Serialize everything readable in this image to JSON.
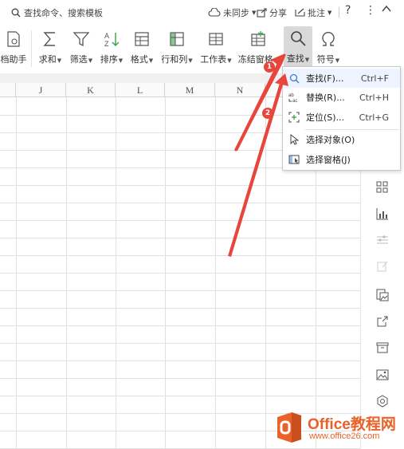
{
  "topbar": {
    "search_placeholder": "查找命令、搜索模板",
    "sync_label": "未同步",
    "share_label": "分享",
    "comment_label": "批注",
    "help_label": "?",
    "more_label": "⋮",
    "collapse_label": "^"
  },
  "ribbon": {
    "items": [
      {
        "label": "档助手",
        "icon": "doc-assistant-icon"
      },
      {
        "label": "求和",
        "icon": "sum-icon",
        "dropdown": true
      },
      {
        "label": "筛选",
        "icon": "filter-icon",
        "dropdown": true
      },
      {
        "label": "排序",
        "icon": "sort-icon",
        "dropdown": true
      },
      {
        "label": "格式",
        "icon": "format-icon",
        "dropdown": true
      },
      {
        "label": "行和列",
        "icon": "rows-cols-icon",
        "dropdown": true
      },
      {
        "label": "工作表",
        "icon": "worksheet-icon",
        "dropdown": true
      },
      {
        "label": "冻结窗格",
        "icon": "freeze-panes-icon",
        "dropdown": true
      },
      {
        "label": "查找",
        "icon": "find-icon",
        "dropdown": true,
        "active": true
      },
      {
        "label": "符号",
        "icon": "symbol-icon",
        "dropdown": true
      }
    ]
  },
  "grid": {
    "columns": [
      "J",
      "K",
      "L",
      "M",
      "N"
    ]
  },
  "find_menu": {
    "items": [
      {
        "label": "查找(F)...",
        "shortcut": "Ctrl+F",
        "icon": "search-icon"
      },
      {
        "label": "替换(R)...",
        "shortcut": "Ctrl+H",
        "icon": "replace-icon"
      },
      {
        "label": "定位(S)...",
        "shortcut": "Ctrl+G",
        "icon": "locate-icon"
      },
      {
        "label": "选择对象(O)",
        "shortcut": "",
        "icon": "cursor-icon"
      },
      {
        "label": "选择窗格(J)",
        "shortcut": "",
        "icon": "selection-pane-icon"
      }
    ]
  },
  "annotations": {
    "badge1": "1",
    "badge2": "2"
  },
  "watermark": {
    "brand": "Office教程网",
    "url": "www.office26.com"
  },
  "colors": {
    "accent_red": "#e8453c",
    "brand_orange": "#e8632a",
    "icon_green": "#3aa14a"
  }
}
